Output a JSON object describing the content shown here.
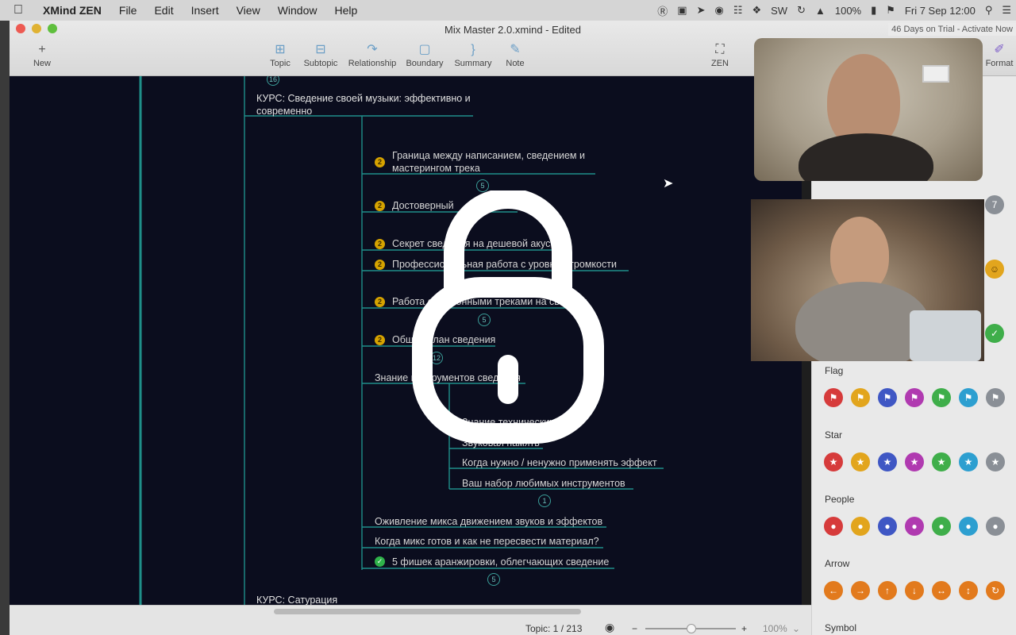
{
  "menubar": {
    "app_name": "XMind ZEN",
    "items": [
      "File",
      "Edit",
      "Insert",
      "View",
      "Window",
      "Help"
    ],
    "sw_label": "SW",
    "battery": "100%",
    "datetime": "Fri 7 Sep  12:00"
  },
  "window": {
    "title": "Mix Master 2.0.xmind - Edited",
    "trial": "46 Days on Trial - Activate Now"
  },
  "toolbar": {
    "new": "New",
    "topic": "Topic",
    "subtopic": "Subtopic",
    "relationship": "Relationship",
    "boundary": "Boundary",
    "summary": "Summary",
    "note": "Note",
    "zen": "ZEN",
    "format": "Format"
  },
  "mindmap": {
    "course1": "КУРС: Сведение своей музыки: эффективно и",
    "course1_line2": "современно",
    "top_count": "16",
    "topics": [
      {
        "l1": "Граница между написанием, сведением и",
        "l2": "мастерингом трека",
        "prio": "2",
        "count": "5"
      },
      {
        "l1": "Достоверный",
        "prio": "2"
      },
      {
        "l1": "Секрет сведения на дешевой акусти",
        "prio": "2"
      },
      {
        "l1": "Профессиональная работа с уровнем громкости",
        "prio": "2"
      },
      {
        "l1": "Работа с эталонными треками на сведени",
        "prio": "2",
        "count": "5"
      },
      {
        "l1": "Общий план сведения",
        "prio": "2",
        "count": "12"
      }
    ],
    "tools": "Знание инструментов сведения",
    "subs": [
      "Знание технических",
      "Звуковая память",
      "Когда нужно / ненужно применять эффект",
      "Ваш набор любимых инструментов"
    ],
    "sub_count": "1",
    "after": [
      "Оживление микса движением звуков и эффектов",
      "Когда микс готов и как не пересвести материал?",
      "5 фишек аранжировки, облегчающих сведение"
    ],
    "after_count": "5",
    "course2": "КУРС: Сатурация"
  },
  "statusbar": {
    "topic_count": "Topic: 1 / 213",
    "zoom": "100%"
  },
  "panel": {
    "flag": "Flag",
    "star": "Star",
    "people": "People",
    "arrow": "Arrow",
    "symbol": "Symbol",
    "number_badge": "7",
    "colors": [
      "#d63b3b",
      "#e2a51d",
      "#3f57c4",
      "#b03ab0",
      "#3fae4a",
      "#2d9fd0",
      "#8a8f96"
    ]
  }
}
